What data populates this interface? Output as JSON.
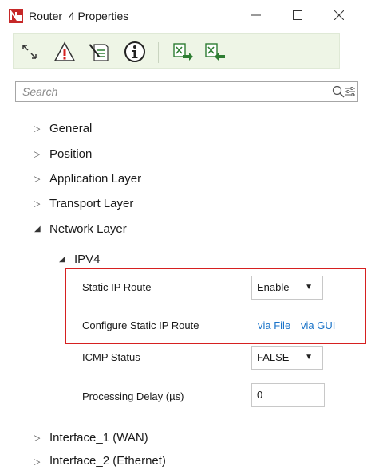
{
  "window": {
    "title": "Router_4 Properties",
    "minimize_label": "—",
    "maximize_label": "☐",
    "close_label": "✕"
  },
  "toolbar": {
    "tools": [
      "expand-collapse-icon",
      "warning-icon",
      "edit-notes-icon",
      "info-icon",
      "export-excel-icon",
      "import-excel-icon"
    ]
  },
  "search": {
    "placeholder": "Search"
  },
  "tree": {
    "general": "General",
    "position": "Position",
    "application_layer": "Application Layer",
    "transport_layer": "Transport Layer",
    "network_layer": "Network Layer",
    "ipv4": "IPV4",
    "interface_1": "Interface_1 (WAN)",
    "interface_2": "Interface_2 (Ethernet)"
  },
  "props": {
    "static_ip_route": {
      "label": "Static IP Route",
      "value": "Enable"
    },
    "configure_static_ip_route": {
      "label": "Configure Static IP Route",
      "link_file": "via File",
      "link_gui": "via GUI"
    },
    "icmp_status": {
      "label": "ICMP Status",
      "value": "FALSE"
    },
    "processing_delay": {
      "label": "Processing Delay (µs)",
      "value": "0"
    }
  },
  "colors": {
    "toolbar_bg": "#eef5e6",
    "highlight": "#d62020",
    "link": "#1a73c8"
  }
}
